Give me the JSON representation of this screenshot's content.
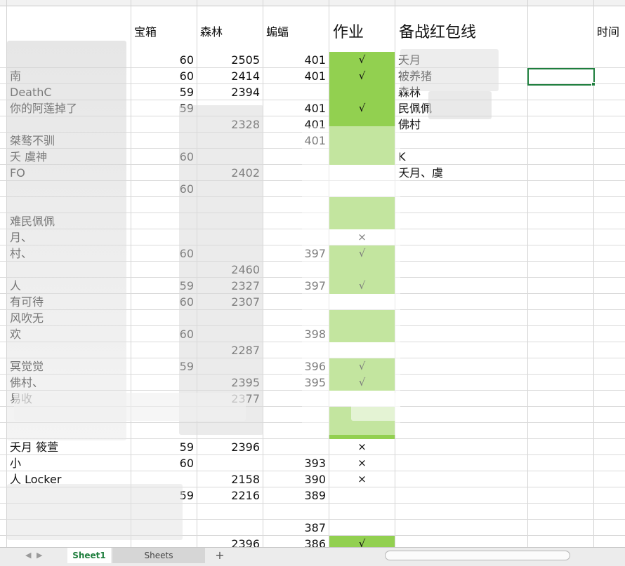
{
  "headers": {
    "c": "宝箱",
    "d": "森林",
    "e": "蝙蝠",
    "f": "作业",
    "g": "备战红包线",
    "i": "时间"
  },
  "rows": [
    {
      "b": "",
      "c": "60",
      "d": "2505",
      "e": "401",
      "f": "√",
      "fg": true,
      "g": "夭月"
    },
    {
      "b": "南",
      "c": "60",
      "d": "2414",
      "e": "401",
      "f": "√",
      "fg": true,
      "g": "被养猪"
    },
    {
      "b": "DeathC",
      "c": "59",
      "d": "2394",
      "e": "",
      "f": "",
      "fg": true,
      "g": "森林"
    },
    {
      "b": "你的阿莲掉了",
      "c": "59",
      "d": "",
      "e": "401",
      "f": "√",
      "fg": true,
      "g": "民佩佩"
    },
    {
      "b": "",
      "c": "",
      "d": "2328",
      "e": "401",
      "f": "",
      "fg": true,
      "g": "佛村"
    },
    {
      "b": "桀骜不驯",
      "c": "",
      "d": "",
      "e": "401",
      "f": "",
      "fg": true,
      "g": ""
    },
    {
      "b": "夭  虞神",
      "c": "60",
      "d": "",
      "e": "",
      "f": "",
      "fg": true,
      "g": "K"
    },
    {
      "b": "FO",
      "c": "",
      "d": "2402",
      "e": "",
      "f": "",
      "fg": false,
      "g": "夭月、虞"
    },
    {
      "b": "",
      "c": "60",
      "d": "",
      "e": "",
      "f": "",
      "fg": false,
      "g": ""
    },
    {
      "b": "",
      "c": "",
      "d": "",
      "e": "",
      "f": "",
      "fg": true,
      "g": ""
    },
    {
      "b": "难民佩佩",
      "c": "",
      "d": "",
      "e": "",
      "f": "",
      "fg": true,
      "g": ""
    },
    {
      "b": "月、",
      "c": "",
      "d": "",
      "e": "",
      "f": "×",
      "fg": false,
      "g": ""
    },
    {
      "b": "村、",
      "c": "60",
      "d": "",
      "e": "397",
      "f": "√",
      "fg": true,
      "g": ""
    },
    {
      "b": "",
      "c": "",
      "d": "2460",
      "e": "",
      "f": "",
      "fg": true,
      "g": ""
    },
    {
      "b": "人",
      "c": "59",
      "d": "2327",
      "e": "397",
      "f": "√",
      "fg": true,
      "g": ""
    },
    {
      "b": "有可待",
      "c": "60",
      "d": "2307",
      "e": "",
      "f": "",
      "fg": false,
      "g": ""
    },
    {
      "b": "风吹无",
      "c": "",
      "d": "",
      "e": "",
      "f": "",
      "fg": true,
      "g": ""
    },
    {
      "b": "欢",
      "c": "60",
      "d": "",
      "e": "398",
      "f": "",
      "fg": true,
      "g": ""
    },
    {
      "b": "",
      "c": "",
      "d": "2287",
      "e": "",
      "f": "",
      "fg": false,
      "g": ""
    },
    {
      "b": "冥觉觉",
      "c": "59",
      "d": "",
      "e": "396",
      "f": "√",
      "fg": true,
      "g": ""
    },
    {
      "b": "佛村、",
      "c": "",
      "d": "2395",
      "e": "395",
      "f": "√",
      "fg": true,
      "g": ""
    },
    {
      "b": "易收",
      "c": "",
      "d": "2377",
      "e": "",
      "f": "",
      "fg": false,
      "g": ""
    },
    {
      "b": "",
      "c": "",
      "d": "",
      "e": "",
      "f": "",
      "fg": true,
      "g": ""
    },
    {
      "b": "",
      "c": "",
      "d": "",
      "e": "",
      "f": "",
      "fg": true,
      "g": ""
    },
    {
      "b": "夭月  筱萱",
      "c": "59",
      "d": "2396",
      "e": "",
      "f": "×",
      "fg": false,
      "g": ""
    },
    {
      "b": "小",
      "c": "60",
      "d": "",
      "e": "393",
      "f": "×",
      "fg": false,
      "g": ""
    },
    {
      "b": "人  Locker",
      "c": "",
      "d": "2158",
      "e": "390",
      "f": "×",
      "fg": false,
      "g": ""
    },
    {
      "b": "",
      "c": "59",
      "d": "2216",
      "e": "389",
      "f": "",
      "fg": false,
      "g": ""
    },
    {
      "b": "",
      "c": "",
      "d": "",
      "e": "",
      "f": "",
      "fg": false,
      "g": ""
    },
    {
      "b": "",
      "c": "",
      "d": "",
      "e": "387",
      "f": "",
      "fg": false,
      "g": ""
    },
    {
      "b": "",
      "c": "",
      "d": "2396",
      "e": "386",
      "f": "√",
      "fg": true,
      "g": ""
    }
  ],
  "sheetbar": {
    "active_tab": "Sheet1",
    "other_tab": "Sheets",
    "add_symbol": "+",
    "left_arrow": "◀",
    "right_arrow": "▶"
  },
  "colors": {
    "green_fill": "#92d050",
    "selection": "#1e7e3d",
    "grid": "#d4d4d4"
  }
}
